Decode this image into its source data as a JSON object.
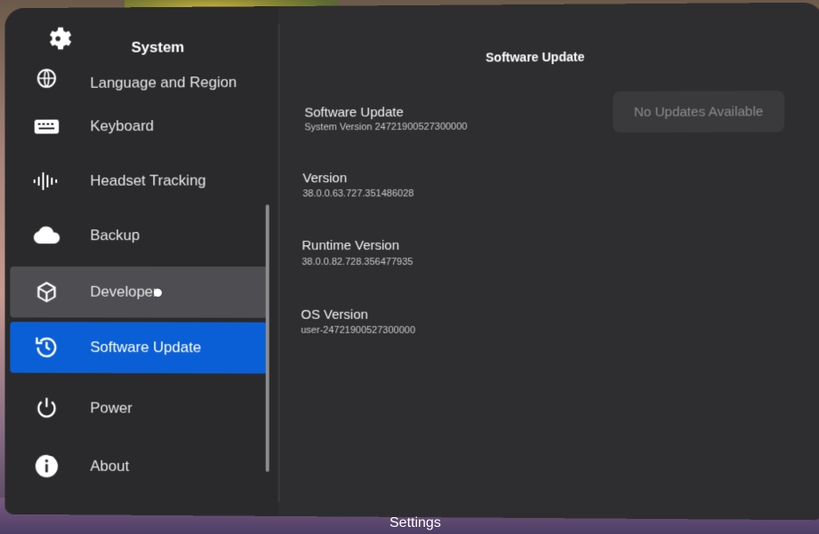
{
  "sidebar": {
    "title": "System",
    "items": [
      {
        "label": "Language and Region",
        "icon": "globe-icon"
      },
      {
        "label": "Keyboard",
        "icon": "keyboard-icon"
      },
      {
        "label": "Headset Tracking",
        "icon": "tracking-icon"
      },
      {
        "label": "Backup",
        "icon": "cloud-icon"
      },
      {
        "label": "Developer",
        "icon": "cube-icon"
      },
      {
        "label": "Software Update",
        "icon": "update-icon",
        "selected": true
      },
      {
        "label": "Power",
        "icon": "power-icon"
      },
      {
        "label": "About",
        "icon": "info-icon"
      }
    ]
  },
  "main": {
    "title": "Software Update",
    "update_button": "No Updates Available",
    "rows": [
      {
        "title": "Software Update",
        "value": "System Version 24721900527300000"
      },
      {
        "title": "Version",
        "value": "38.0.0.63.727.351486028"
      },
      {
        "title": "Runtime Version",
        "value": "38.0.0.82.728.356477935"
      },
      {
        "title": "OS Version",
        "value": "user-24721900527300000"
      }
    ]
  },
  "footer": {
    "label": "Settings"
  },
  "colors": {
    "accent": "#0b5fd6",
    "panel": "#2e2e30",
    "hover": "#4e4e52"
  }
}
